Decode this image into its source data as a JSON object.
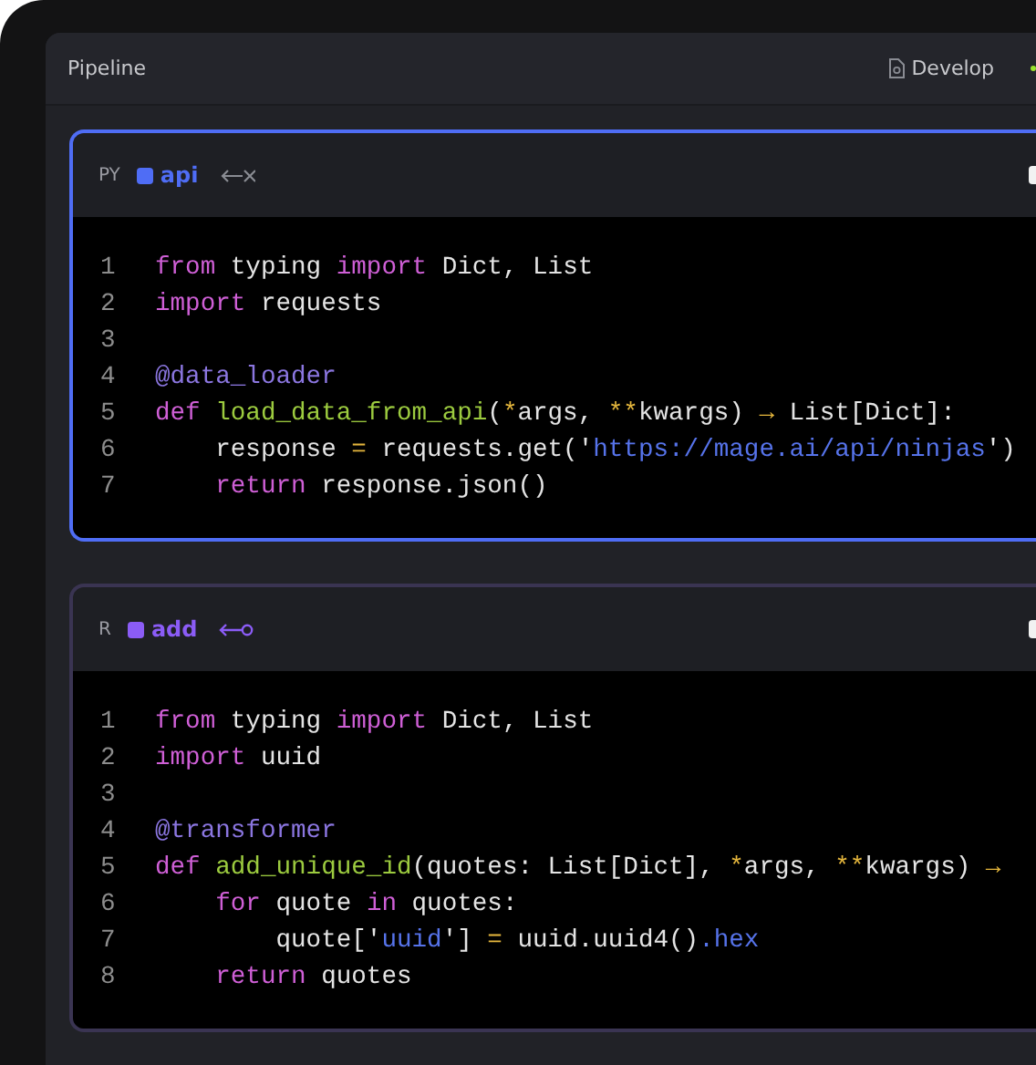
{
  "header": {
    "title": "Pipeline",
    "mode": "Develop"
  },
  "blocks": [
    {
      "kind": "unlinked",
      "language": "PY",
      "name": "api",
      "color": "#4f6df5",
      "selected": true,
      "lines": [
        {
          "number": "1",
          "tokens": [
            {
              "kind": "keyword",
              "text": "from"
            },
            {
              "kind": "plain",
              "text": " typing "
            },
            {
              "kind": "keyword",
              "text": "import"
            },
            {
              "kind": "plain",
              "text": " Dict, List"
            }
          ]
        },
        {
          "number": "2",
          "tokens": [
            {
              "kind": "keyword",
              "text": "import"
            },
            {
              "kind": "plain",
              "text": " requests"
            }
          ]
        },
        {
          "number": "3"
        },
        {
          "number": "4",
          "tokens": [
            {
              "kind": "decorator",
              "text": "@data_loader"
            }
          ]
        },
        {
          "number": "5",
          "tokens": [
            {
              "kind": "keyword",
              "text": "def "
            },
            {
              "kind": "function",
              "text": "load_data_from_api"
            },
            {
              "kind": "plain",
              "text": "("
            },
            {
              "kind": "operator",
              "text": "*"
            },
            {
              "kind": "plain",
              "text": "args, "
            },
            {
              "kind": "operator",
              "text": "**"
            },
            {
              "kind": "plain",
              "text": "kwargs) "
            },
            {
              "kind": "operator",
              "text": "→"
            },
            {
              "kind": "plain",
              "text": " List[Dict]:"
            }
          ]
        },
        {
          "number": "6",
          "tokens": [
            {
              "kind": "plain",
              "text": "    response "
            },
            {
              "kind": "operator",
              "text": "="
            },
            {
              "kind": "plain",
              "text": " requests.get('"
            },
            {
              "kind": "string",
              "text": "https://mage.ai/api/ninjas"
            },
            {
              "kind": "plain",
              "text": "')"
            }
          ]
        },
        {
          "number": "7",
          "tokens": [
            {
              "kind": "keyword",
              "text": "    return"
            },
            {
              "kind": "plain",
              "text": " response.json()"
            }
          ]
        }
      ]
    },
    {
      "kind": "linked",
      "language": "R",
      "name": "add",
      "color": "#8b5cf6",
      "selected": false,
      "lines": [
        {
          "number": "1",
          "tokens": [
            {
              "kind": "keyword",
              "text": "from"
            },
            {
              "kind": "plain",
              "text": " typing "
            },
            {
              "kind": "keyword",
              "text": "import"
            },
            {
              "kind": "plain",
              "text": " Dict, List"
            }
          ]
        },
        {
          "number": "2",
          "tokens": [
            {
              "kind": "keyword",
              "text": "import"
            },
            {
              "kind": "plain",
              "text": " uuid"
            }
          ]
        },
        {
          "number": "3"
        },
        {
          "number": "4",
          "tokens": [
            {
              "kind": "decorator",
              "text": "@transformer"
            }
          ]
        },
        {
          "number": "5",
          "tokens": [
            {
              "kind": "keyword",
              "text": "def "
            },
            {
              "kind": "function",
              "text": "add_unique_id"
            },
            {
              "kind": "plain",
              "text": "(quotes: List[Dict], "
            },
            {
              "kind": "operator",
              "text": "*"
            },
            {
              "kind": "plain",
              "text": "args, "
            },
            {
              "kind": "operator",
              "text": "**"
            },
            {
              "kind": "plain",
              "text": "kwargs) "
            },
            {
              "kind": "operator",
              "text": "→"
            }
          ]
        },
        {
          "number": "6",
          "tokens": [
            {
              "kind": "keyword",
              "text": "    for"
            },
            {
              "kind": "plain",
              "text": " quote "
            },
            {
              "kind": "keyword",
              "text": "in"
            },
            {
              "kind": "plain",
              "text": " quotes:"
            }
          ]
        },
        {
          "number": "7",
          "tokens": [
            {
              "kind": "plain",
              "text": "        quote['"
            },
            {
              "kind": "string",
              "text": "uuid"
            },
            {
              "kind": "plain",
              "text": "'] "
            },
            {
              "kind": "operator",
              "text": "="
            },
            {
              "kind": "plain",
              "text": " uuid.uuid4()"
            },
            {
              "kind": "string",
              "text": ".hex"
            }
          ]
        },
        {
          "number": "8",
          "tokens": [
            {
              "kind": "keyword",
              "text": "    return"
            },
            {
              "kind": "plain",
              "text": " quotes"
            }
          ]
        }
      ]
    }
  ]
}
